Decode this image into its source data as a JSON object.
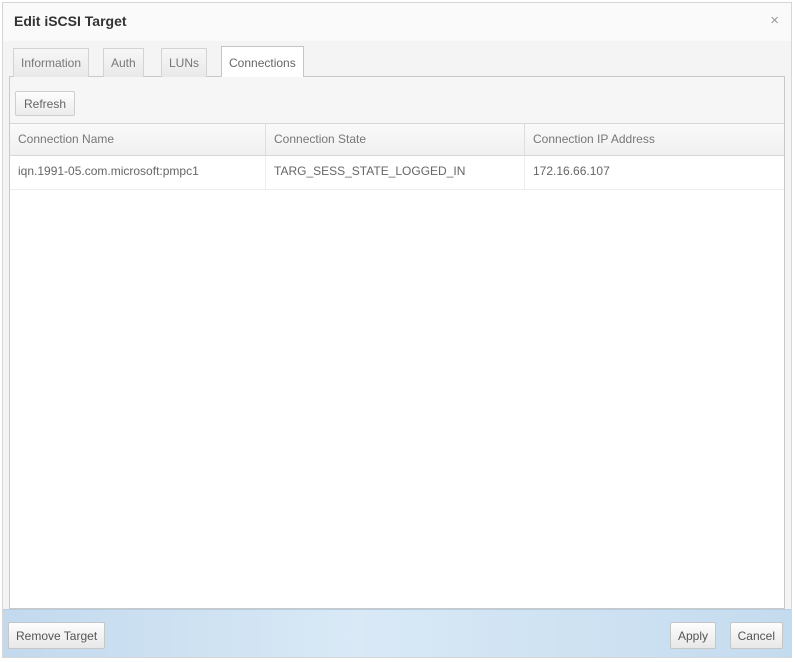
{
  "dialog": {
    "title": "Edit iSCSI Target",
    "close_glyph": "×"
  },
  "tabs": [
    {
      "label": "Information",
      "active": false
    },
    {
      "label": "Auth",
      "active": false
    },
    {
      "label": "LUNs",
      "active": false
    },
    {
      "label": "Connections",
      "active": true
    }
  ],
  "toolbar": {
    "refresh_label": "Refresh"
  },
  "table": {
    "columns": [
      "Connection Name",
      "Connection State",
      "Connection IP Address"
    ],
    "rows": [
      [
        "iqn.1991-05.com.microsoft:pmpc1",
        "TARG_SESS_STATE_LOGGED_IN",
        "172.16.66.107"
      ]
    ]
  },
  "footer": {
    "remove_label": "Remove Target",
    "apply_label": "Apply",
    "cancel_label": "Cancel"
  },
  "icons": {
    "close": "close-icon"
  },
  "colors": {
    "footer_accent": "#cfe2f3",
    "panel_bg": "#ffffff",
    "dialog_bg": "#f4f4f4"
  }
}
